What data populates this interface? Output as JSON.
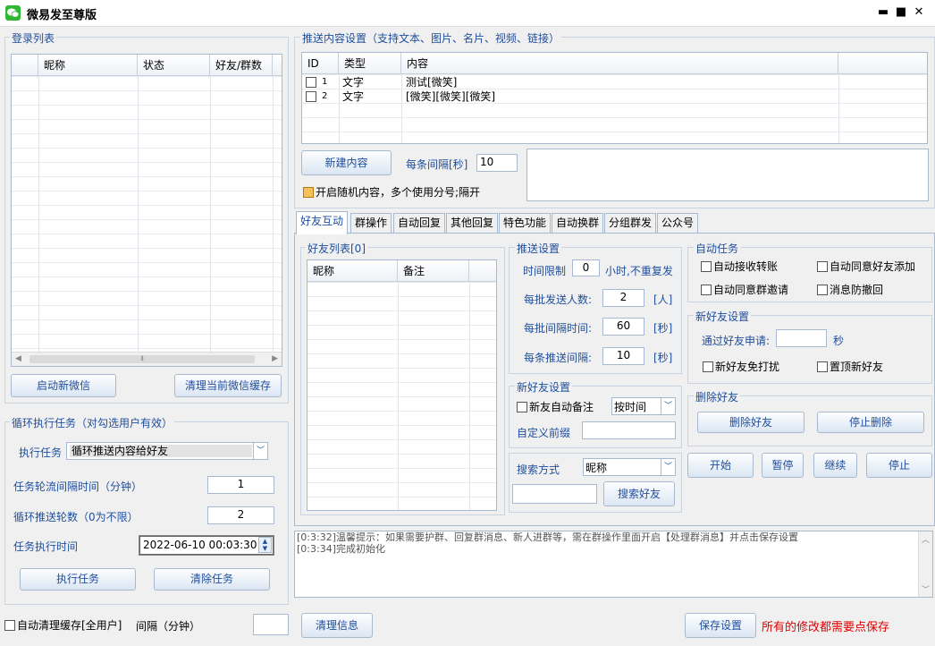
{
  "window": {
    "title": "微易发至尊版",
    "min": "▬",
    "max": "■",
    "close": "✕"
  },
  "login": {
    "group_label": "登录列表",
    "columns": [
      "",
      "昵称",
      "状态",
      "好友/群数"
    ],
    "scroll_mark": "⦀",
    "btn_start": "启动新微信",
    "btn_clear_cache": "清理当前微信缓存"
  },
  "loop": {
    "group_label": "循环执行任务（对勾选用户有效）",
    "task_label": "执行任务",
    "task_value": "循环推送内容给好友",
    "interval_label": "任务轮流间隔时间（分钟）",
    "interval_value": "1",
    "rounds_label": "循环推送轮数（0为不限）",
    "rounds_value": "2",
    "time_label": "任务执行时间",
    "time_value": "2022-06-10 00:03:30",
    "btn_exec": "执行任务",
    "btn_clear": "清除任务"
  },
  "auto_clean": {
    "label": "自动清理缓存[全用户]",
    "interval_label": "间隔（分钟）",
    "value": ""
  },
  "push_content": {
    "group_label": "推送内容设置（支持文本、图片、名片、视频、链接）",
    "columns": [
      "ID",
      "类型",
      "内容"
    ],
    "rows": [
      {
        "id": "1",
        "type": "文字",
        "content": "测试[微笑]"
      },
      {
        "id": "2",
        "type": "文字",
        "content": "[微笑][微笑][微笑]"
      }
    ],
    "btn_new": "新建内容",
    "interval_label": "每条间隔[秒]",
    "interval_value": "10",
    "random_label": "开启随机内容，多个使用分号;隔开"
  },
  "tabs": [
    "好友互动",
    "群操作",
    "自动回复",
    "其他回复",
    "特色功能",
    "自动换群",
    "分组群发",
    "公众号"
  ],
  "friends": {
    "group_label": "好友列表[0]",
    "columns": [
      "昵称",
      "备注"
    ]
  },
  "push_settings": {
    "group_label": "推送设置",
    "time_limit_label": "时间限制",
    "time_limit_value": "0",
    "time_limit_suffix": "小时,不重复发",
    "batch_count_label": "每批发送人数:",
    "batch_count_value": "2",
    "batch_count_unit": "[人]",
    "batch_interval_label": "每批间隔时间:",
    "batch_interval_value": "60",
    "batch_interval_unit": "[秒]",
    "item_interval_label": "每条推送间隔:",
    "item_interval_value": "10",
    "item_interval_unit": "[秒]"
  },
  "new_friend_left": {
    "group_label": "新好友设置",
    "auto_note_label": "新友自动备注",
    "mode_value": "按时间",
    "prefix_label": "自定义前缀",
    "prefix_value": ""
  },
  "search": {
    "label": "搜索方式",
    "mode_value": "昵称",
    "input_value": "",
    "btn": "搜索好友"
  },
  "auto_tasks": {
    "group_label": "自动任务",
    "items": [
      "自动接收转账",
      "自动同意好友添加",
      "自动同意群邀请",
      "消息防撤回"
    ]
  },
  "new_friend_right": {
    "group_label": "新好友设置",
    "pass_label": "通过好友申请:",
    "pass_value": "",
    "pass_unit": "秒",
    "no_disturb_label": "新好友免打扰",
    "pin_label": "置顶新好友"
  },
  "delete_friend": {
    "group_label": "删除好友",
    "btn_delete": "删除好友",
    "btn_stop": "停止删除"
  },
  "controls": {
    "start": "开始",
    "pause": "暂停",
    "resume": "继续",
    "stop": "停止"
  },
  "log": {
    "lines": [
      "[0:3:32]温馨提示：如果需要护群、回复群消息、新人进群等，需在群操作里面开启【处理群消息】并点击保存设置",
      "[0:3:34]完成初始化"
    ]
  },
  "footer": {
    "btn_clear_info": "清理信息",
    "btn_save": "保存设置",
    "save_hint": "所有的修改都需要点保存",
    "hint_color": "#e00000"
  }
}
